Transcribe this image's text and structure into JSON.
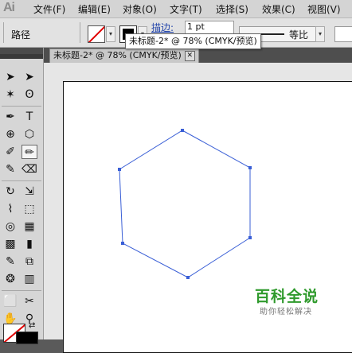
{
  "app": {
    "logo_text": "Ai"
  },
  "menu": [
    "文件(F)",
    "编辑(E)",
    "对象(O)",
    "文字(T)",
    "选择(S)",
    "效果(C)",
    "视图(V)"
  ],
  "control_bar": {
    "selection_label": "路径",
    "stroke_label": "描边:",
    "stroke_weight": "1 pt",
    "profile_label": "等比"
  },
  "tooltip": {
    "text": "未标题-2* @ 78% (CMYK/预览)"
  },
  "document": {
    "tab_title": "未标题-2* @ 78% (CMYK/预览)",
    "close_glyph": "✕"
  },
  "watermark": {
    "title": "百科全说",
    "subtitle": "助你轻松解决"
  },
  "colors": {
    "path_stroke": "#3a5fd6",
    "fill_none_slash": "#e00000",
    "watermark_green": "#2f9a2c"
  },
  "tools": [
    {
      "name": "selection-tool",
      "glyph": "➤"
    },
    {
      "name": "direct-selection-tool",
      "glyph": "➤"
    },
    {
      "name": "magic-wand-tool",
      "glyph": "✶"
    },
    {
      "name": "lasso-tool",
      "glyph": "ʘ"
    },
    {
      "name": "pen-tool",
      "glyph": "✒"
    },
    {
      "name": "type-tool",
      "glyph": "T"
    },
    {
      "name": "line-tool",
      "glyph": "⊕"
    },
    {
      "name": "shape-tool",
      "glyph": "⬡"
    },
    {
      "name": "paintbrush-tool",
      "glyph": "✐"
    },
    {
      "name": "pencil-tool",
      "glyph": "✏"
    },
    {
      "name": "blob-brush-tool",
      "glyph": "✎"
    },
    {
      "name": "eraser-tool",
      "glyph": "⌫"
    },
    {
      "name": "rotate-tool",
      "glyph": "↻"
    },
    {
      "name": "scale-tool",
      "glyph": "⇲"
    },
    {
      "name": "warp-tool",
      "glyph": "⌇"
    },
    {
      "name": "free-transform-tool",
      "glyph": "⬚"
    },
    {
      "name": "shape-builder-tool",
      "glyph": "◎"
    },
    {
      "name": "perspective-grid-tool",
      "glyph": "▦"
    },
    {
      "name": "mesh-tool",
      "glyph": "▩"
    },
    {
      "name": "gradient-tool",
      "glyph": "▮"
    },
    {
      "name": "eyedropper-tool",
      "glyph": "✎"
    },
    {
      "name": "blend-tool",
      "glyph": "⧉"
    },
    {
      "name": "symbol-sprayer-tool",
      "glyph": "❂"
    },
    {
      "name": "graph-tool",
      "glyph": "▥"
    },
    {
      "name": "artboard-tool",
      "glyph": "⬜"
    },
    {
      "name": "slice-tool",
      "glyph": "✂"
    },
    {
      "name": "hand-tool",
      "glyph": "✋"
    },
    {
      "name": "zoom-tool",
      "glyph": "⚲"
    }
  ]
}
